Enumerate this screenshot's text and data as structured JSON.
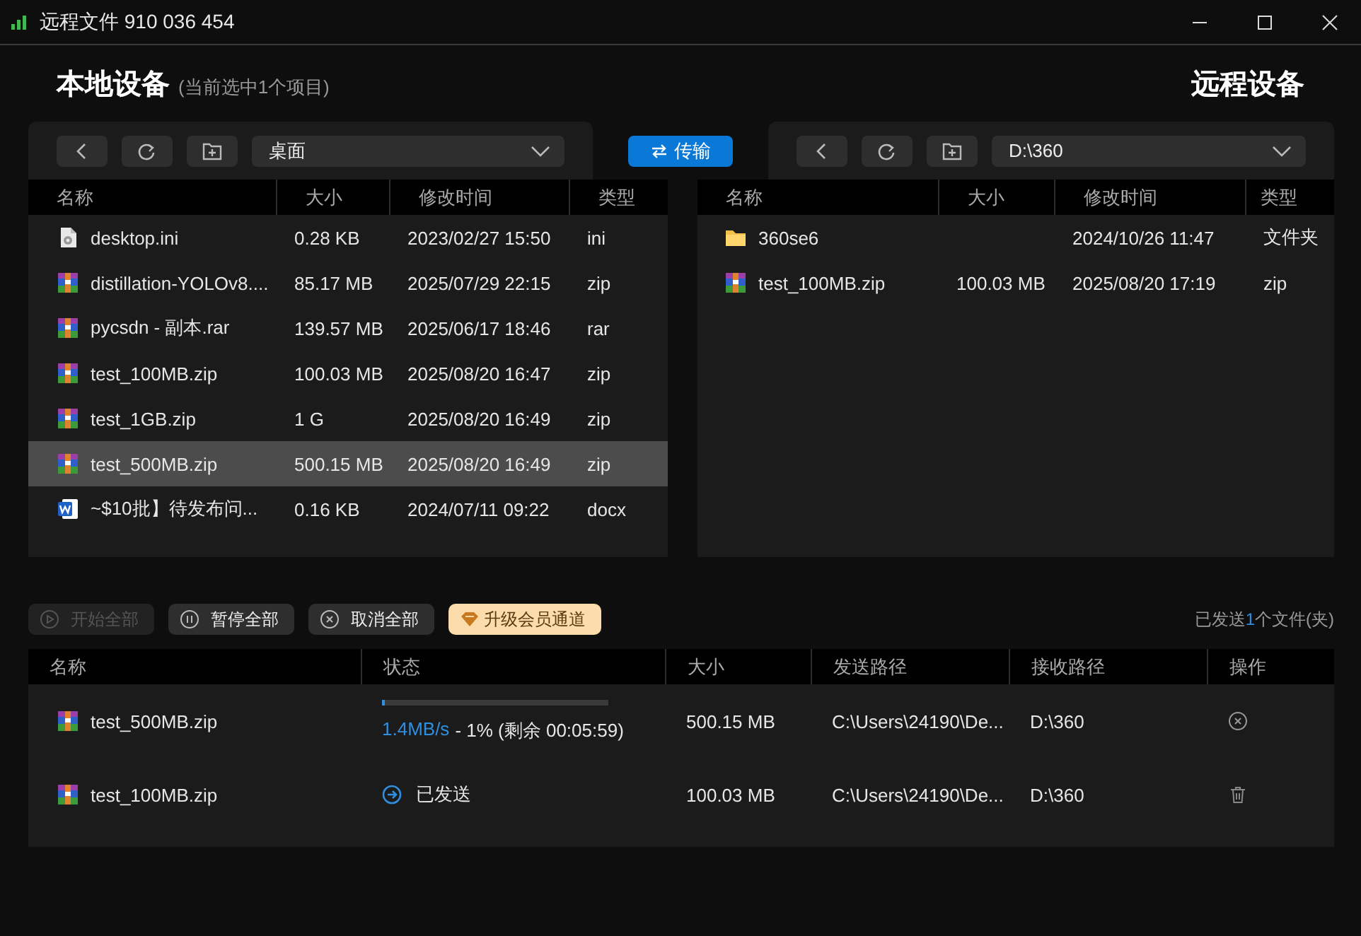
{
  "window": {
    "title": "远程文件 910 036 454"
  },
  "local": {
    "heading": "本地设备",
    "note": "(当前选中1个项目)",
    "path": "桌面",
    "columns": [
      "名称",
      "大小",
      "修改时间",
      "类型"
    ],
    "rows": [
      {
        "kind": "ini",
        "name": "desktop.ini",
        "size": "0.28 KB",
        "modified": "2023/02/27 15:50",
        "type": "ini",
        "selected": false
      },
      {
        "kind": "archive",
        "name": "distillation-YOLOv8....",
        "size": "85.17 MB",
        "modified": "2025/07/29 22:15",
        "type": "zip",
        "selected": false
      },
      {
        "kind": "archive",
        "name": "pycsdn - 副本.rar",
        "size": "139.57 MB",
        "modified": "2025/06/17 18:46",
        "type": "rar",
        "selected": false
      },
      {
        "kind": "archive",
        "name": "test_100MB.zip",
        "size": "100.03 MB",
        "modified": "2025/08/20 16:47",
        "type": "zip",
        "selected": false
      },
      {
        "kind": "archive",
        "name": "test_1GB.zip",
        "size": "1 G",
        "modified": "2025/08/20 16:49",
        "type": "zip",
        "selected": false
      },
      {
        "kind": "archive",
        "name": "test_500MB.zip",
        "size": "500.15 MB",
        "modified": "2025/08/20 16:49",
        "type": "zip",
        "selected": true
      },
      {
        "kind": "word",
        "name": "~$10批】待发布问...",
        "size": "0.16 KB",
        "modified": "2024/07/11 09:22",
        "type": "docx",
        "selected": false
      }
    ]
  },
  "transfer_button": "传输",
  "remote": {
    "heading": "远程设备",
    "path": "D:\\360",
    "columns": [
      "名称",
      "大小",
      "修改时间",
      "类型"
    ],
    "rows": [
      {
        "kind": "folder",
        "name": "360se6",
        "modified": "2024/10/26 11:47",
        "type": "文件夹",
        "selected": false
      },
      {
        "kind": "archive",
        "name": "test_100MB.zip",
        "size": "100.03 MB",
        "modified": "2025/08/20 17:19",
        "type": "zip",
        "selected": false
      }
    ]
  },
  "queue": {
    "buttons": [
      {
        "kind": "start",
        "label": "开始全部",
        "disabled": true
      },
      {
        "kind": "pause",
        "label": "暂停全部",
        "disabled": false
      },
      {
        "kind": "cancel",
        "label": "取消全部",
        "disabled": false
      },
      {
        "kind": "premium",
        "label": "升级会员通道",
        "disabled": false
      }
    ],
    "summary": {
      "prefix": "已发送",
      "count": "1",
      "suffix": "个文件(夹)"
    },
    "columns": [
      "名称",
      "状态",
      "大小",
      "发送路径",
      "接收路径",
      "操作"
    ],
    "rows": [
      {
        "kind": "archive",
        "name": "test_500MB.zip",
        "status": {
          "kind": "progress",
          "level": 0.01,
          "speed": "1.4MB/s",
          "detail": "- 1% (剩余 00:05:59)"
        },
        "size": "500.15 MB",
        "source": "C:\\Users\\24190\\De...",
        "target": "D:\\360",
        "action": {
          "kind": "cancel"
        }
      },
      {
        "kind": "archive",
        "name": "test_100MB.zip",
        "status": {
          "kind": "sent",
          "label": "已发送"
        },
        "size": "100.03 MB",
        "source": "C:\\Users\\24190\\De...",
        "target": "D:\\360",
        "action": {
          "kind": "delete"
        }
      }
    ]
  }
}
